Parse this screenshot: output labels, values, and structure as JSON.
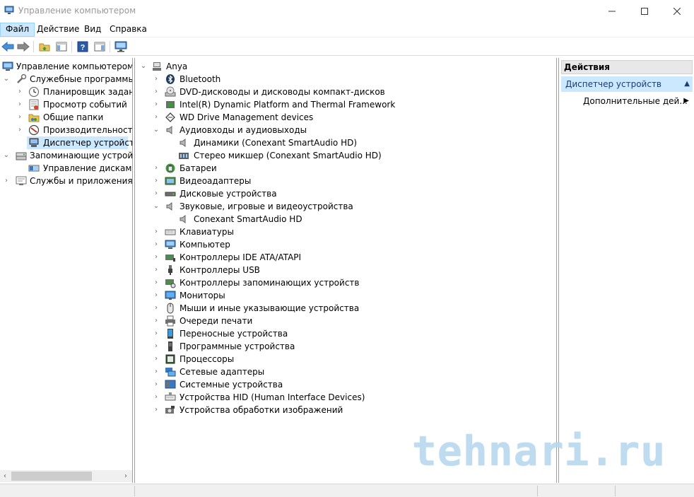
{
  "window": {
    "title": "Управление компьютером",
    "minimize_label": "minimize",
    "maximize_label": "maximize",
    "close_label": "close"
  },
  "menubar": {
    "items": [
      {
        "label": "Файл"
      },
      {
        "label": "Действие"
      },
      {
        "label": "Вид"
      },
      {
        "label": "Справка"
      }
    ]
  },
  "toolbar": {
    "buttons": [
      "back-arrow-icon",
      "forward-arrow-icon",
      "up-folder-icon",
      "show-hide-console-tree-icon",
      "help-icon",
      "action-pane-icon",
      "monitor-icon"
    ]
  },
  "left_tree": {
    "root": "Управление компьютером (л",
    "items": [
      {
        "label": "Служебные программы",
        "level": 1,
        "expanded": true
      },
      {
        "label": "Планировщик заданий",
        "level": 2
      },
      {
        "label": "Просмотр событий",
        "level": 2
      },
      {
        "label": "Общие папки",
        "level": 2
      },
      {
        "label": "Производительность",
        "level": 2
      },
      {
        "label": "Диспетчер устройств",
        "level": 2,
        "selected": true
      },
      {
        "label": "Запоминающие устройст",
        "level": 1,
        "expanded": true
      },
      {
        "label": "Управление дисками",
        "level": 2
      },
      {
        "label": "Службы и приложения",
        "level": 1
      }
    ]
  },
  "device_tree": {
    "root": "Anya",
    "items": [
      {
        "label": "Bluetooth",
        "icon": "bluetooth-icon"
      },
      {
        "label": "DVD-дисководы и дисководы компакт-дисков",
        "icon": "dvd-icon"
      },
      {
        "label": "Intel(R) Dynamic Platform and Thermal Framework",
        "icon": "chip-icon"
      },
      {
        "label": "WD Drive Management devices",
        "icon": "diamond-icon"
      },
      {
        "label": "Аудиовходы и аудиовыходы",
        "icon": "speaker-icon",
        "expanded": true
      },
      {
        "label": "Динамики (Conexant SmartAudio HD)",
        "icon": "speaker-icon",
        "child": true
      },
      {
        "label": "Стерео микшер (Conexant SmartAudio HD)",
        "icon": "mixer-icon",
        "child": true
      },
      {
        "label": "Батареи",
        "icon": "battery-icon"
      },
      {
        "label": "Видеоадаптеры",
        "icon": "display-adapter-icon"
      },
      {
        "label": "Дисковые устройства",
        "icon": "disk-icon"
      },
      {
        "label": "Звуковые, игровые и видеоустройства",
        "icon": "speaker-icon",
        "expanded": true
      },
      {
        "label": "Conexant SmartAudio HD",
        "icon": "speaker-icon",
        "child": true
      },
      {
        "label": "Клавиатуры",
        "icon": "keyboard-icon"
      },
      {
        "label": "Компьютер",
        "icon": "computer-icon"
      },
      {
        "label": "Контроллеры IDE ATA/ATAPI",
        "icon": "ide-controller-icon"
      },
      {
        "label": "Контроллеры USB",
        "icon": "usb-icon"
      },
      {
        "label": "Контроллеры запоминающих устройств",
        "icon": "storage-controller-icon"
      },
      {
        "label": "Мониторы",
        "icon": "monitor-icon"
      },
      {
        "label": "Мыши и иные указывающие устройства",
        "icon": "mouse-icon"
      },
      {
        "label": "Очереди печати",
        "icon": "printer-icon"
      },
      {
        "label": "Переносные устройства",
        "icon": "portable-device-icon"
      },
      {
        "label": "Программные устройства",
        "icon": "software-device-icon"
      },
      {
        "label": "Процессоры",
        "icon": "processor-icon"
      },
      {
        "label": "Сетевые адаптеры",
        "icon": "network-adapter-icon"
      },
      {
        "label": "Системные устройства",
        "icon": "system-device-icon"
      },
      {
        "label": "Устройства HID (Human Interface Devices)",
        "icon": "hid-icon"
      },
      {
        "label": "Устройства обработки изображений",
        "icon": "imaging-device-icon"
      }
    ]
  },
  "actions": {
    "header": "Действия",
    "section": "Диспетчер устройств",
    "item": "Дополнительные дей..."
  },
  "watermark": "tehnari.ru",
  "colors": {
    "selection": "#cce8ff",
    "accent_blue": "#1979ca",
    "watermark": "#b9d8ee"
  }
}
